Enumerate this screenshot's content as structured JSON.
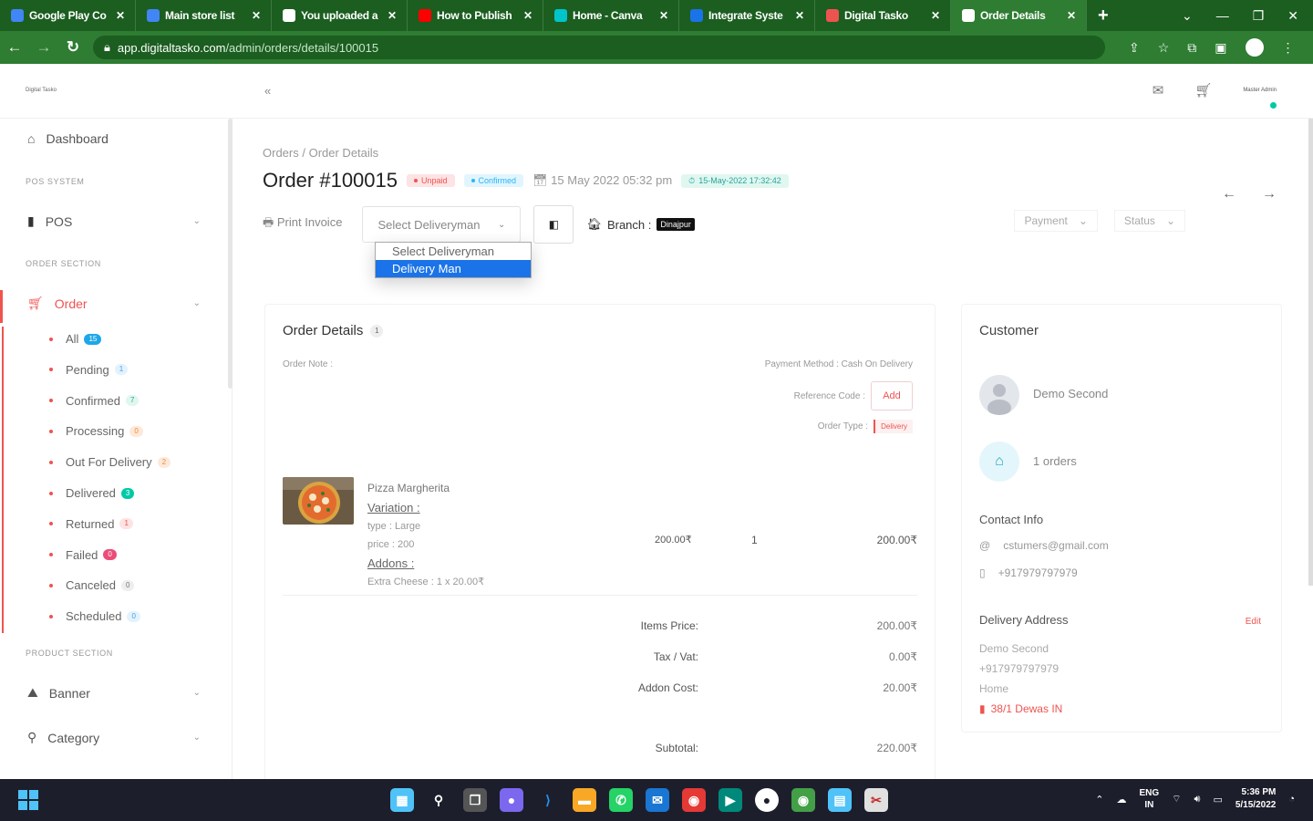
{
  "browser": {
    "tabs": [
      {
        "label": "Google Play Co",
        "color": "#4285f4"
      },
      {
        "label": "Main store list",
        "color": "#4285f4"
      },
      {
        "label": "You uploaded a",
        "color": "#ffffff"
      },
      {
        "label": "How to Publish",
        "color": "#ff0000"
      },
      {
        "label": "Home - Canva",
        "color": "#00c4cc"
      },
      {
        "label": "Integrate Syste",
        "color": "#1a73e8"
      },
      {
        "label": "Digital Tasko",
        "color": "#ef5350"
      },
      {
        "label": "Order Details",
        "color": "#ffffff"
      }
    ],
    "new_tab": "+",
    "url_host": "app.digitaltasko.com",
    "url_path": "/admin/orders/details/100015"
  },
  "header": {
    "logo_text": "Digital Tasko",
    "collapse_icon": "«",
    "user_label": "Master Admin"
  },
  "sidebar": {
    "dashboard": "Dashboard",
    "pos_section": "POS SYSTEM",
    "pos": "POS",
    "order_section": "ORDER SECTION",
    "order": "Order",
    "sub_items": [
      {
        "label": "All",
        "count": "15",
        "bg": "#1ea7e8",
        "fg": "#ffffff"
      },
      {
        "label": "Pending",
        "count": "1",
        "bg": "#e3f2fd",
        "fg": "#42a5f5"
      },
      {
        "label": "Confirmed",
        "count": "7",
        "bg": "#e0f7f0",
        "fg": "#26a69a"
      },
      {
        "label": "Processing",
        "count": "0",
        "bg": "#fde9d9",
        "fg": "#f08a3c"
      },
      {
        "label": "Out For Delivery",
        "count": "2",
        "bg": "#fde9d9",
        "fg": "#f08a3c"
      },
      {
        "label": "Delivered",
        "count": "3",
        "bg": "#00c9a7",
        "fg": "#ffffff"
      },
      {
        "label": "Returned",
        "count": "1",
        "bg": "#fde3e3",
        "fg": "#ef5350"
      },
      {
        "label": "Failed",
        "count": "0",
        "bg": "#ed4c78",
        "fg": "#ffffff"
      },
      {
        "label": "Canceled",
        "count": "0",
        "bg": "#eeeeee",
        "fg": "#777777"
      },
      {
        "label": "Scheduled",
        "count": "0",
        "bg": "#e3f2fd",
        "fg": "#42a5f5"
      }
    ],
    "product_section": "PRODUCT SECTION",
    "banner": "Banner",
    "category": "Category"
  },
  "order": {
    "breadcrumb": [
      "Orders",
      "Order Details"
    ],
    "title": "Order #100015",
    "status_unpaid": "Unpaid",
    "status_confirmed": "Confirmed",
    "date": "15 May 2022 05:32 pm",
    "schedule": "15-May-2022 17:32:42",
    "print_invoice": "Print Invoice",
    "select_placeholder": "Select Deliveryman",
    "dropdown_options": [
      "Select Deliveryman",
      "Delivery Man"
    ],
    "branch_label": "Branch :",
    "branch_name": "Dinajpur",
    "payment_filter": "Payment",
    "status_filter": "Status"
  },
  "details": {
    "title": "Order Details",
    "count": "1",
    "order_note": "Order Note :",
    "payment_method": "Payment Method : Cash On Delivery",
    "reference_label": "Reference Code :",
    "add_label": "Add",
    "order_type_label": "Order Type :",
    "order_type": "Delivery",
    "item": {
      "name": "Pizza Margherita",
      "variation_label": "Variation :",
      "type_line": "type : Large",
      "price_line": "price : 200",
      "addons_label": "Addons :",
      "addon_line": "Extra Cheese : 1 x 20.00₹",
      "unit_price": "200.00₹",
      "qty": "1",
      "total": "200.00₹"
    },
    "totals": [
      {
        "label": "Items Price:",
        "value": "200.00₹"
      },
      {
        "label": "Tax / Vat:",
        "value": "0.00₹"
      },
      {
        "label": "Addon Cost:",
        "value": "20.00₹"
      }
    ],
    "subtotal_label": "Subtotal:",
    "subtotal": "220.00₹"
  },
  "customer": {
    "title": "Customer",
    "name": "Demo Second",
    "orders": "1 orders",
    "contact_title": "Contact Info",
    "email": "cstumers@gmail.com",
    "phone": "+917979797979",
    "delivery_title": "Delivery Address",
    "edit": "Edit",
    "addr_name": "Demo Second",
    "addr_phone": "+917979797979",
    "addr_type": "Home",
    "addr_location": "38/1 Dewas IN"
  },
  "taskbar": {
    "lang_top": "ENG",
    "lang_bottom": "IN",
    "time": "5:36 PM",
    "date": "5/15/2022"
  }
}
